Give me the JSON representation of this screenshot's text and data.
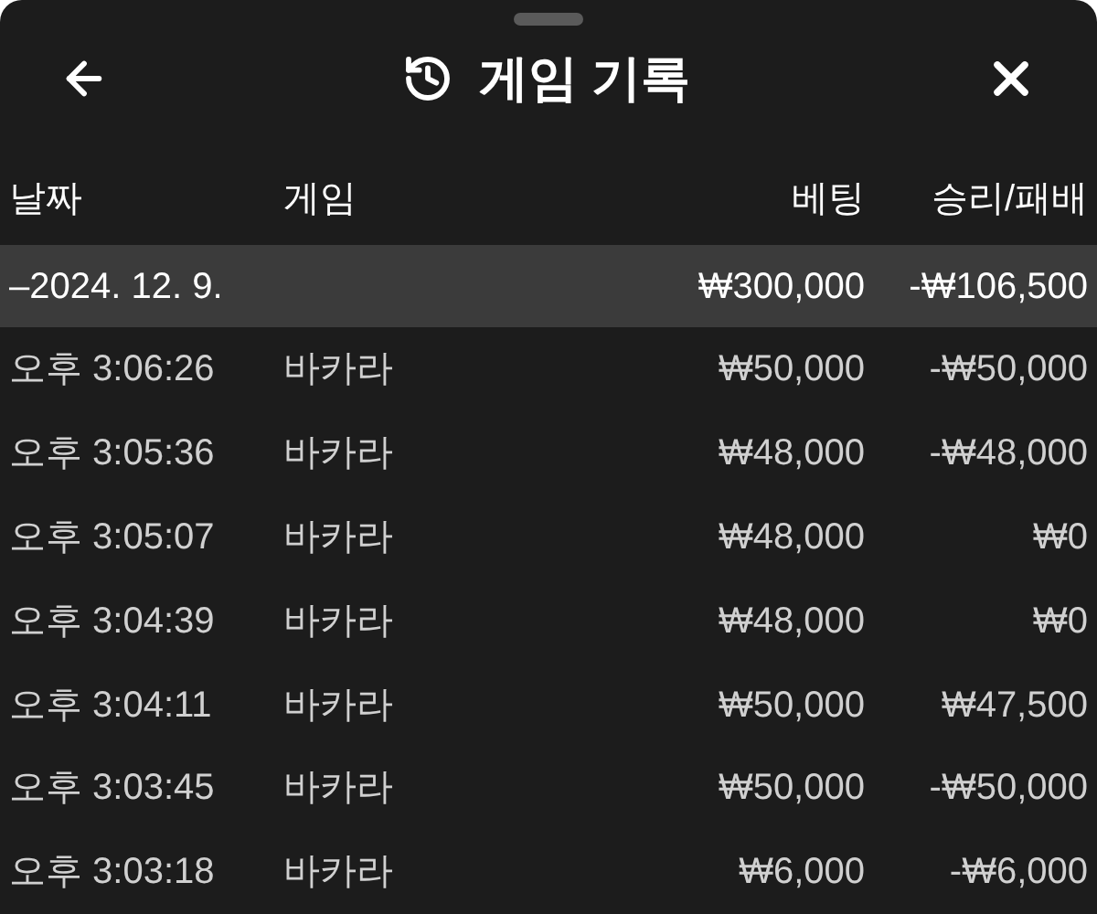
{
  "header": {
    "title": "게임 기록"
  },
  "table": {
    "columns": [
      "날짜",
      "게임",
      "베팅",
      "승리/패배"
    ],
    "groups": [
      {
        "date": "–2024. 12. 9.",
        "bet": "₩300,000",
        "result": "-₩106,500",
        "rows": [
          {
            "time": "오후 3:06:26",
            "game": "바카라",
            "bet": "₩50,000",
            "result": "-₩50,000"
          },
          {
            "time": "오후 3:05:36",
            "game": "바카라",
            "bet": "₩48,000",
            "result": "-₩48,000"
          },
          {
            "time": "오후 3:05:07",
            "game": "바카라",
            "bet": "₩48,000",
            "result": "₩0"
          },
          {
            "time": "오후 3:04:39",
            "game": "바카라",
            "bet": "₩48,000",
            "result": "₩0"
          },
          {
            "time": "오후 3:04:11",
            "game": "바카라",
            "bet": "₩50,000",
            "result": "₩47,500"
          },
          {
            "time": "오후 3:03:45",
            "game": "바카라",
            "bet": "₩50,000",
            "result": "-₩50,000"
          },
          {
            "time": "오후 3:03:18",
            "game": "바카라",
            "bet": "₩6,000",
            "result": "-₩6,000"
          }
        ]
      }
    ]
  }
}
